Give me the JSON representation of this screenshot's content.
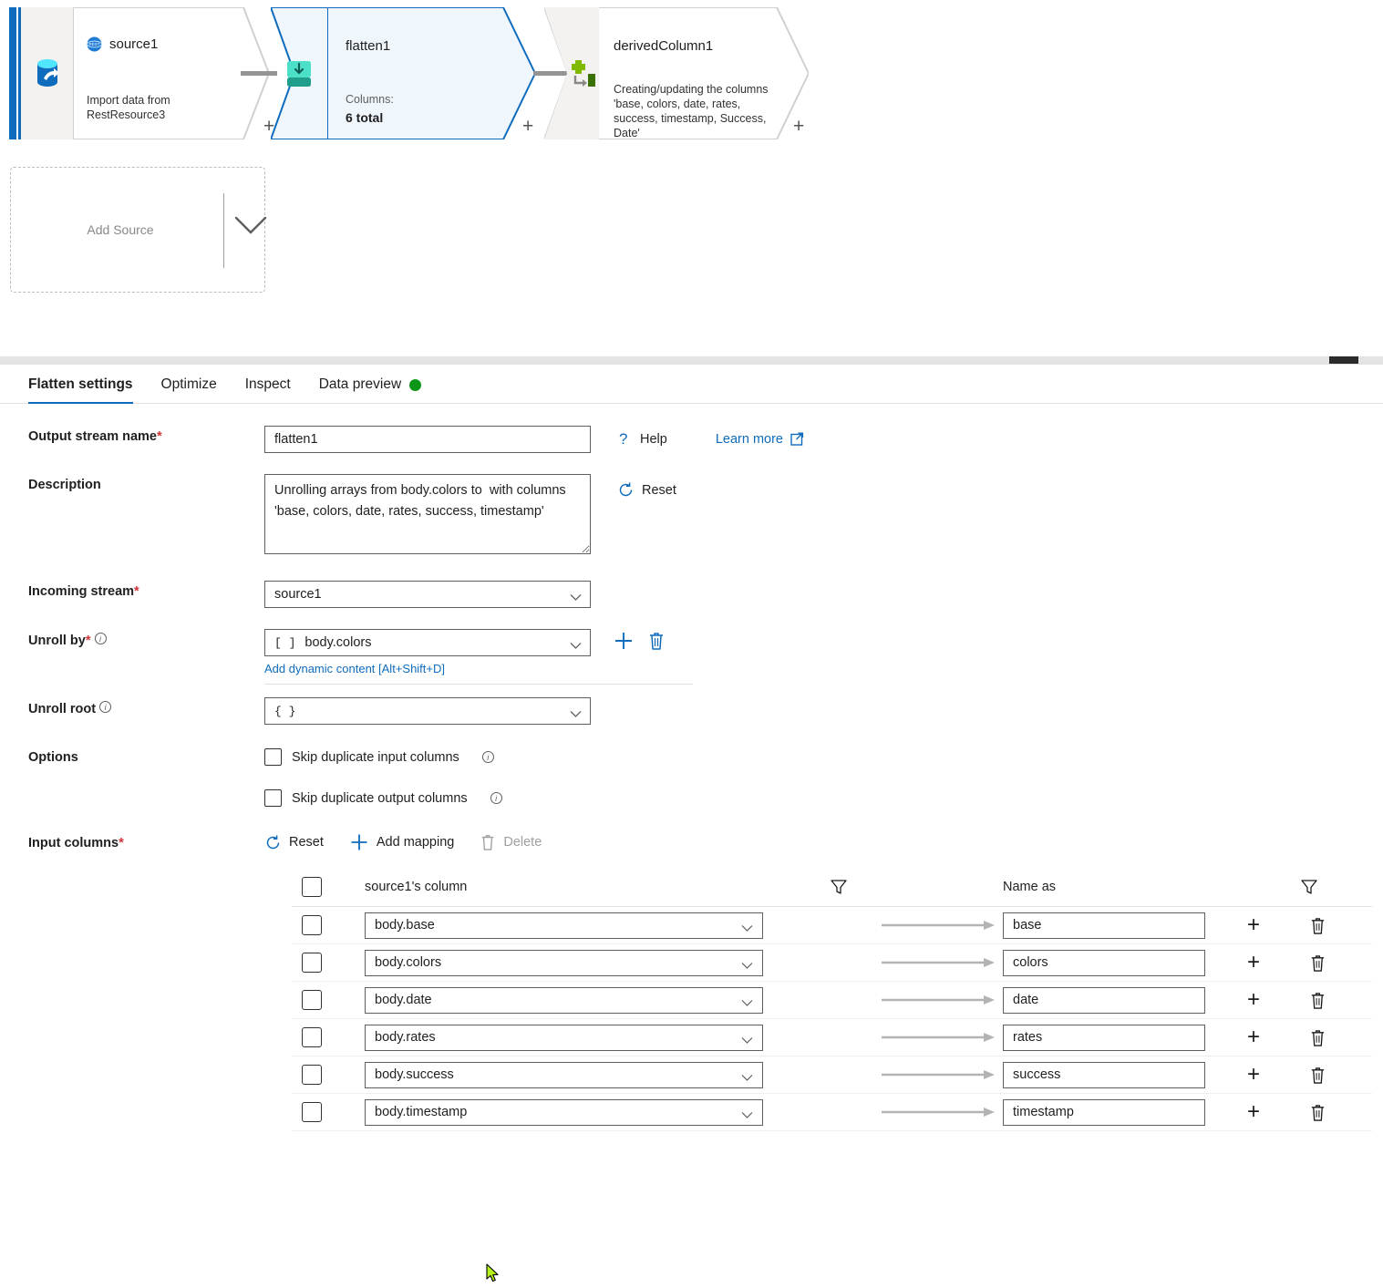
{
  "canvas": {
    "nodes": [
      {
        "id": "source1",
        "title": "source1",
        "badge_icon": "rest-source-icon",
        "description": "Import data from RestResource3",
        "selected": false
      },
      {
        "id": "flatten1",
        "title": "flatten1",
        "icon": "flatten-icon",
        "sub_label": "Columns:",
        "sub_value": "6 total",
        "selected": true
      },
      {
        "id": "derivedColumn1",
        "title": "derivedColumn1",
        "icon": "derived-column-icon",
        "description": "Creating/updating the columns 'base, colors, date, rates, success, timestamp, Success, Date'",
        "selected": false
      }
    ],
    "add_node_plus_label": "+",
    "add_source": {
      "label": "Add Source",
      "chevron_icon": "chevron-down-icon"
    }
  },
  "tabs": [
    {
      "label": "Flatten settings",
      "active": true,
      "status_dot": false
    },
    {
      "label": "Optimize",
      "active": false,
      "status_dot": false
    },
    {
      "label": "Inspect",
      "active": false,
      "status_dot": false
    },
    {
      "label": "Data preview",
      "active": false,
      "status_dot": true
    }
  ],
  "colors": {
    "accent": "#0f6cbd",
    "status_dot_green": "#0c9618",
    "required_red": "#d13438",
    "flatten_node_fill": "#eff6fc",
    "flatten_icon_teal": "#2ec4b6",
    "derived_icon_green": "#7fba00"
  },
  "form": {
    "output_stream_name": {
      "label": "Output stream name",
      "required": "*",
      "value": "flatten1"
    },
    "description": {
      "label": "Description",
      "value": "Unrolling arrays from body.colors to  with columns 'base, colors, date, rates, success, timestamp'"
    },
    "incoming_stream": {
      "label": "Incoming stream",
      "required": "*",
      "value": "source1"
    },
    "unroll_by": {
      "label": "Unroll by",
      "required": "*",
      "bracket": "[ ]",
      "value": "body.colors",
      "dynamic_content_link": "Add dynamic content [Alt+Shift+D]"
    },
    "unroll_root": {
      "label": "Unroll root",
      "bracket": "{ }",
      "value": ""
    },
    "options": {
      "label": "Options",
      "checkboxes": [
        {
          "label": "Skip duplicate input columns",
          "checked": false
        },
        {
          "label": "Skip duplicate output columns",
          "checked": false
        }
      ]
    },
    "input_columns": {
      "label": "Input columns",
      "required": "*"
    },
    "help_link": "Help",
    "learn_more_link": "Learn more",
    "reset_link": "Reset"
  },
  "mapping_toolbar": {
    "reset": "Reset",
    "add_mapping": "Add mapping",
    "delete": "Delete"
  },
  "mapping_table": {
    "headers": {
      "source_column": "source1's column",
      "name_as": "Name as"
    },
    "rows": [
      {
        "source": "body.base",
        "name_as": "base",
        "checked": false
      },
      {
        "source": "body.colors",
        "name_as": "colors",
        "checked": false
      },
      {
        "source": "body.date",
        "name_as": "date",
        "checked": false
      },
      {
        "source": "body.rates",
        "name_as": "rates",
        "checked": false
      },
      {
        "source": "body.success",
        "name_as": "success",
        "checked": false
      },
      {
        "source": "body.timestamp",
        "name_as": "timestamp",
        "checked": false
      }
    ]
  }
}
